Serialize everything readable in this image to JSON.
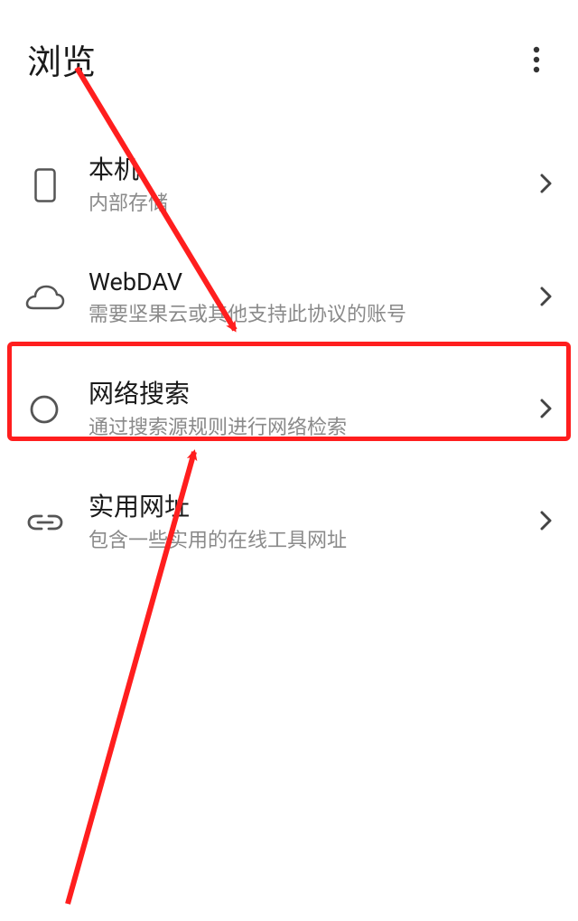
{
  "header": {
    "title": "浏览"
  },
  "items": [
    {
      "title": "本机",
      "subtitle": "内部存储",
      "icon": "phone-icon"
    },
    {
      "title": "WebDAV",
      "subtitle": "需要坚果云或其他支持此协议的账号",
      "icon": "cloud-icon"
    },
    {
      "title": "网络搜索",
      "subtitle": "通过搜索源规则进行网络检索",
      "icon": "search-icon"
    },
    {
      "title": "实用网址",
      "subtitle": "包含一些实用的在线工具网址",
      "icon": "link-icon"
    }
  ]
}
